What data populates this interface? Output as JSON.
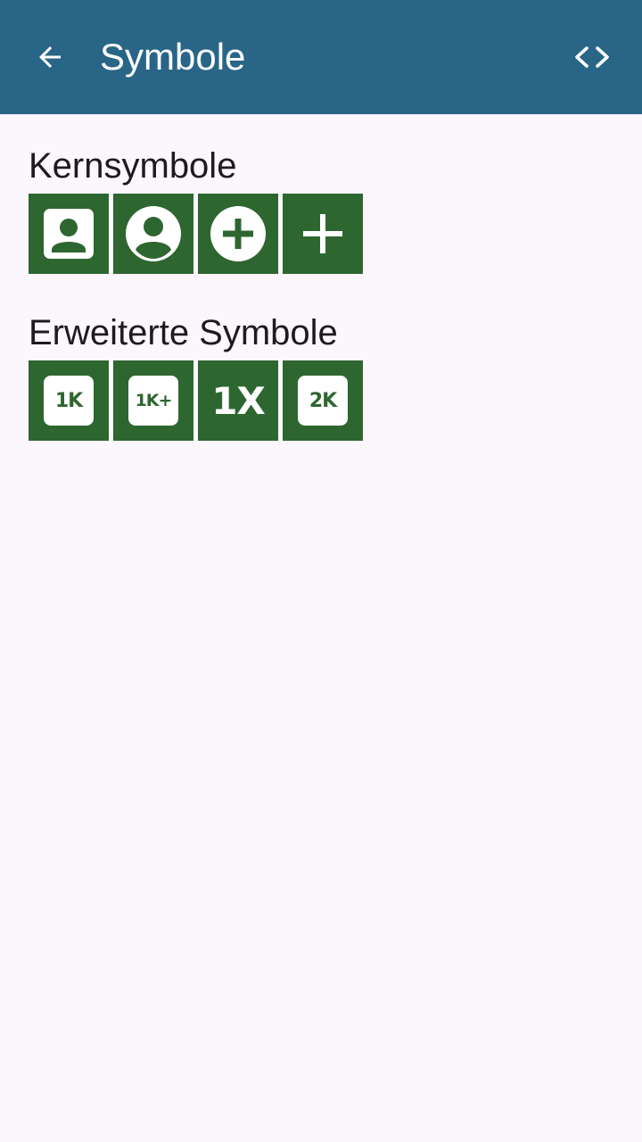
{
  "appbar": {
    "title": "Symbole",
    "back_icon": "arrow-left-icon",
    "code_icon": "code-brackets-icon",
    "background": "#296587"
  },
  "sections": [
    {
      "title": "Kernsymbole",
      "icons": [
        {
          "name": "contact-card-icon"
        },
        {
          "name": "account-circle-icon"
        },
        {
          "name": "add-circle-icon"
        },
        {
          "name": "plus-icon"
        }
      ]
    },
    {
      "title": "Erweiterte Symbole",
      "icons": [
        {
          "name": "1k-icon",
          "label": "1K"
        },
        {
          "name": "1k-plus-icon",
          "label": "1K+"
        },
        {
          "name": "1x-icon",
          "label": "1X"
        },
        {
          "name": "2k-icon",
          "label": "2K"
        }
      ]
    }
  ],
  "colors": {
    "tile": "#2e6630",
    "background": "#fcf6fd",
    "text": "#1d1b20"
  }
}
